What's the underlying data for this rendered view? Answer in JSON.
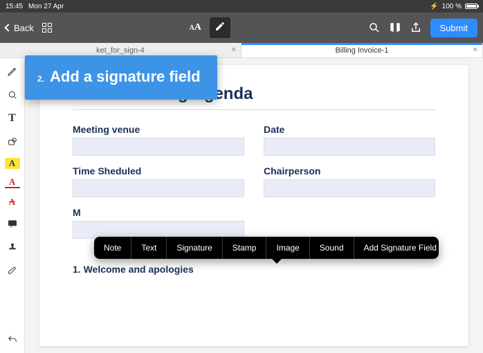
{
  "status": {
    "time": "15:45",
    "date": "Mon 27 Apr",
    "battery_pct": "100 %"
  },
  "toolbar": {
    "back_label": "Back",
    "aa_label": "A",
    "aa_small": "A",
    "submit_label": "Submit"
  },
  "tabs": [
    {
      "label": "ket_for_sign-4",
      "active": false
    },
    {
      "label": "Billing Invoice-1",
      "active": true
    }
  ],
  "tutorial": {
    "step_num": "2.",
    "text": "Add a signature field"
  },
  "document": {
    "title": "Board Meeting Agenda",
    "fields": {
      "venue_label": "Meeting venue",
      "date_label": "Date",
      "time_label": "Time Sheduled",
      "chair_label": "Chairperson",
      "minutes_label": "M"
    },
    "agenda_item_1": "1.   Welcome and apologies"
  },
  "context_menu": {
    "items": [
      "Note",
      "Text",
      "Signature",
      "Stamp",
      "Image",
      "Sound",
      "Add Signature Field"
    ]
  },
  "vtoolbar": {
    "highlight_glyph": "A",
    "underline_glyph": "A",
    "strike_glyph": "A",
    "text_glyph": "T"
  }
}
